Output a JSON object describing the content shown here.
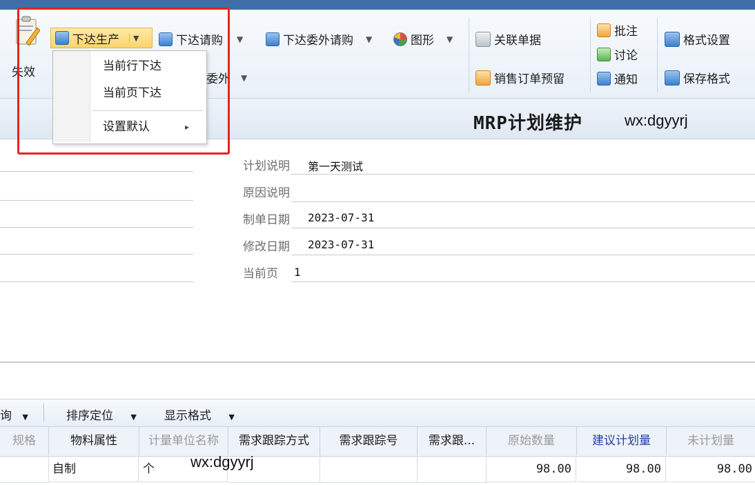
{
  "ribbon": {
    "shixiao_label": "失效",
    "xiada_shengchan": "下达生产",
    "xiada_qinggou": "下达请购",
    "xiada_weiwai_qinggou": "下达委外请购",
    "tuxing": "图形",
    "weiwai_partial": "委外",
    "guanlian_danju": "关联单据",
    "xiaoshou_dingdan_yuliu": "销售订单预留",
    "pizhu": "批注",
    "taolun": "讨论",
    "tongzhi": "通知",
    "geshi_shezhi": "格式设置",
    "baocun_geshi": "保存格式"
  },
  "dropdown": {
    "items": [
      "当前行下达",
      "当前页下达",
      "设置默认"
    ],
    "submenu_arrow": "▸"
  },
  "header": {
    "title": "MRP计划维护",
    "watermark": "wx:dgyyrj"
  },
  "form": {
    "fields": [
      {
        "label": "计划说明",
        "value": "第一天测试"
      },
      {
        "label": "原因说明",
        "value": ""
      },
      {
        "label": "制单日期",
        "value": "2023-07-31"
      },
      {
        "label": "修改日期",
        "value": "2023-07-31"
      },
      {
        "label": "当前页",
        "value": "1"
      }
    ]
  },
  "gridbar": {
    "query_partial": "询",
    "sort_locate": "排序定位",
    "display_format": "显示格式"
  },
  "table": {
    "columns": [
      "规格",
      "物料属性",
      "计量单位名称",
      "需求跟踪方式",
      "需求跟踪号",
      "需求跟...",
      "原始数量",
      "建议计划量",
      "未计划量"
    ],
    "rows": [
      {
        "spec": "",
        "material_attr": "自制",
        "unit": "个",
        "track_mode": "",
        "track_no": "",
        "track_more": "",
        "orig_qty": "98.00",
        "suggest_qty": "98.00",
        "unplanned_qty": "98.00"
      }
    ],
    "watermark": "wx:dgyyrj"
  },
  "colors": {
    "highlight_box": "#e8231f",
    "ribbon_top": "#3f6ea8",
    "suggest_header": "#1f3fa8"
  }
}
